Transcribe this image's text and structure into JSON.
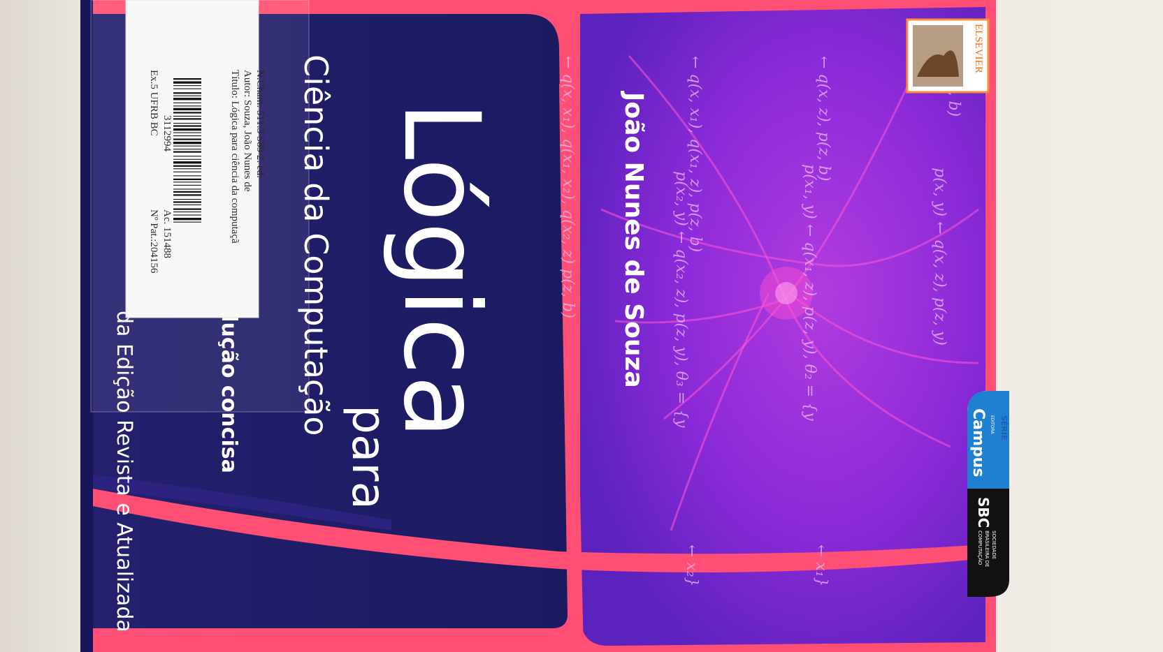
{
  "cover": {
    "title": "Lógica",
    "connector": "para",
    "subtitle": "Ciência da Computação",
    "tagline_left": "",
    "tagline": "dução concisa",
    "edition": "da Edição Revista e Atualizada",
    "author": "João Nunes de Souza"
  },
  "publisher": {
    "elsevier": "ELSEVIER",
    "serie": "SÉRIE",
    "editora": "EDITORA",
    "campus": "Campus",
    "sbc": "SBC",
    "sbc_full": [
      "SOCIEDADE",
      "BRASILEIRA DE",
      "COMPUTAÇÃO"
    ]
  },
  "library_label": {
    "line1": "N.Cham.  511.3  S89 2. ed.",
    "line2": "Autor: Souza, João Nunes de",
    "line3": "Título: Lógica para ciência da computaçã",
    "line4_a": "Ex.5  UFRB  BC",
    "line4_b": "Ac. 151488",
    "barcode_number": "3112994",
    "patrimonio": "Nº Pat.:204156"
  },
  "formulas": [
    "← p(x, b)",
    "p(x, y) ← q(x, z), p(z, y)",
    "← q(x, z), p(z, b)",
    "p(x₁, y) ← q(x₁, z), p(z, y), θ₂ = {y",
    "← q(x, x₁), q(x₁, z), p(z, b)",
    "p(x₂, y) ← q(x₂, z), p(z, y), θ₃ = {y",
    "← q(x, x₁), q(x₁, x₂), q(x₂, z) p(z, b)",
    "← x₁}",
    "← x₂}"
  ],
  "colors": {
    "navy": "#1e1b6e",
    "purple": "#8a2ad6",
    "coral": "#ff4f74",
    "white": "#ffffff"
  }
}
